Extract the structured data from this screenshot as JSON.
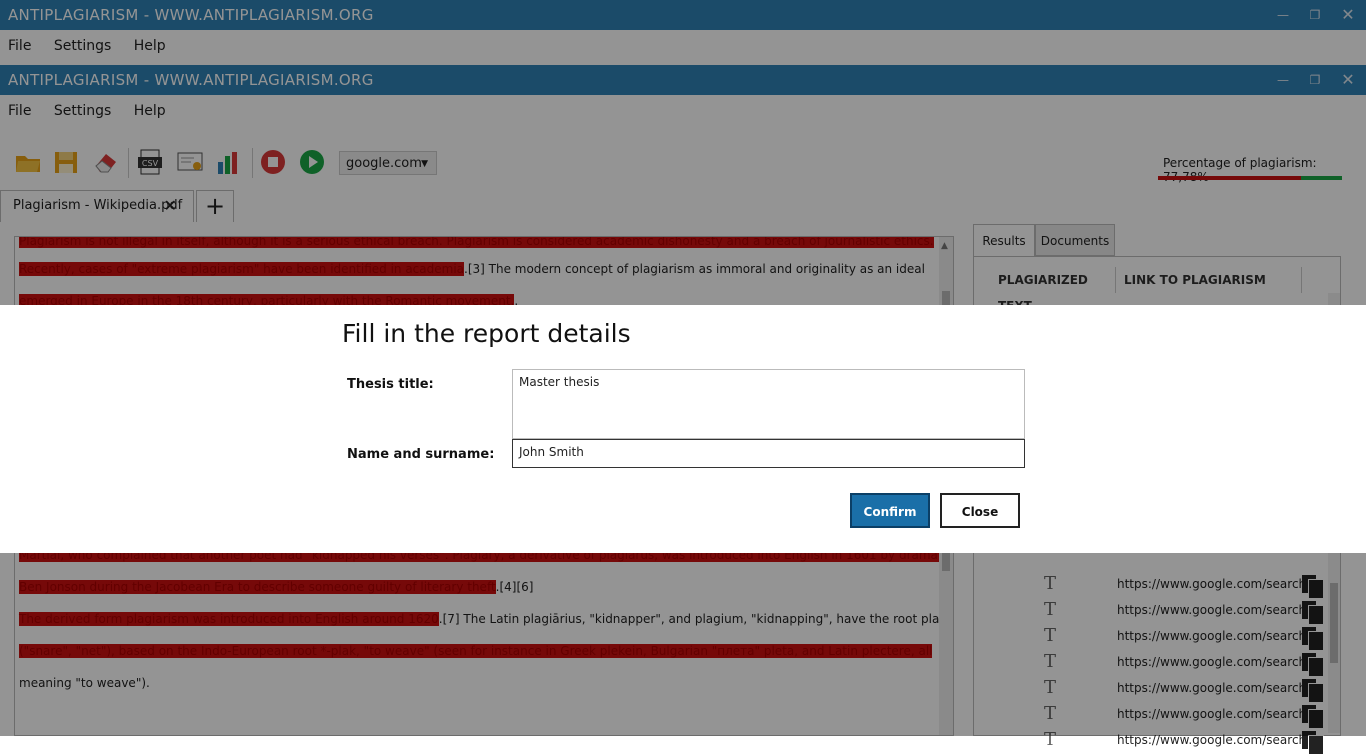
{
  "outer_window": {
    "title": "ANTIPLAGIARISM - WWW.ANTIPLAGIARISM.ORG"
  },
  "outer_menu": [
    "File",
    "Settings",
    "Help"
  ],
  "inner_window": {
    "title": "ANTIPLAGIARISM - WWW.ANTIPLAGIARISM.ORG"
  },
  "inner_menu": [
    "File",
    "Settings",
    "Help"
  ],
  "toolbar": {
    "icons": [
      "open-folder-icon",
      "save-icon",
      "eraser-icon",
      "csv-export-icon",
      "certificate-icon",
      "chart-icon",
      "stop-icon",
      "play-icon"
    ],
    "search_engine": "google.com",
    "percentage_label": "Percentage of plagiarism: 77,78%",
    "percentage_value": 77.78
  },
  "tabs": {
    "doc_tab": "Plagiarism - Wikipedia.pdf",
    "add_tab": "+"
  },
  "document": {
    "lines": [
      [
        {
          "t": "Plagiarism is not illegal in itself, although it is a serious ethical breach. Plagiarism is considered academic dishonesty and a breach of journalistic ethics.",
          "h": true
        }
      ],
      [
        {
          "t": "Recently, cases of \"extreme plagiarism\" have been identified in academia",
          "h": true
        },
        {
          "t": ".[3] The modern concept of plagiarism as immoral and originality as an ideal",
          "h": false
        }
      ],
      [
        {
          "t": "emerged in Europe in the 18th century, particularly with the Romantic movement.",
          "h": true
        },
        {
          "t": ".",
          "h": false
        }
      ],
      [
        {
          "t": "Martial, who complained that another poet had \"kidnapped his verses\". Plagiary, a derivative of plagiarus, was introduced into English in 1601 by dramatist",
          "h": true
        }
      ],
      [
        {
          "t": "Ben Jonson during the Jacobean Era to describe someone guilty of literary theft",
          "h": true
        },
        {
          "t": ".[4][6]",
          "h": false
        }
      ],
      [
        {
          "t": "The derived form plagiarism was introduced into English around 1620",
          "h": true
        },
        {
          "t": ".[7] The Latin plagiārius, \"kidnapper\", and plagium, \"kidnapping\", have the root plaga",
          "h": false
        }
      ],
      [
        {
          "t": "(\"snare\", \"net\"), based on the Indo-European root *-plak, \"to weave\" (seen for instance in Greek plekein, Bulgarian \"плета\" pleta, and Latin plectere, all",
          "h": true
        }
      ],
      [
        {
          "t": "meaning \"to weave\").",
          "h": false
        }
      ]
    ]
  },
  "results_panel": {
    "tabs": [
      "Results",
      "Documents"
    ],
    "columns": [
      "PLAGIARIZED TEXT",
      "LINK TO PLAGIARISM"
    ],
    "rows": [
      "https://www.google.com/search?q",
      "https://www.google.com/search?q",
      "https://www.google.com/search?q",
      "https://www.google.com/search?q",
      "https://www.google.com/search?q",
      "https://www.google.com/search?q",
      "https://www.google.com/search?q",
      "https://www.google.com/search?q"
    ]
  },
  "dialog": {
    "title": "Fill in the report details",
    "thesis_label": "Thesis title:",
    "thesis_value": "Master thesis",
    "name_label": "Name and surname:",
    "name_value": "John Smith",
    "confirm_label": "Confirm",
    "close_label": "Close"
  },
  "colors": {
    "titlebar": "#2f82b6",
    "highlight": "#cc1010",
    "primary_button": "#1a6fa8",
    "progress_ok": "#1aa845"
  }
}
